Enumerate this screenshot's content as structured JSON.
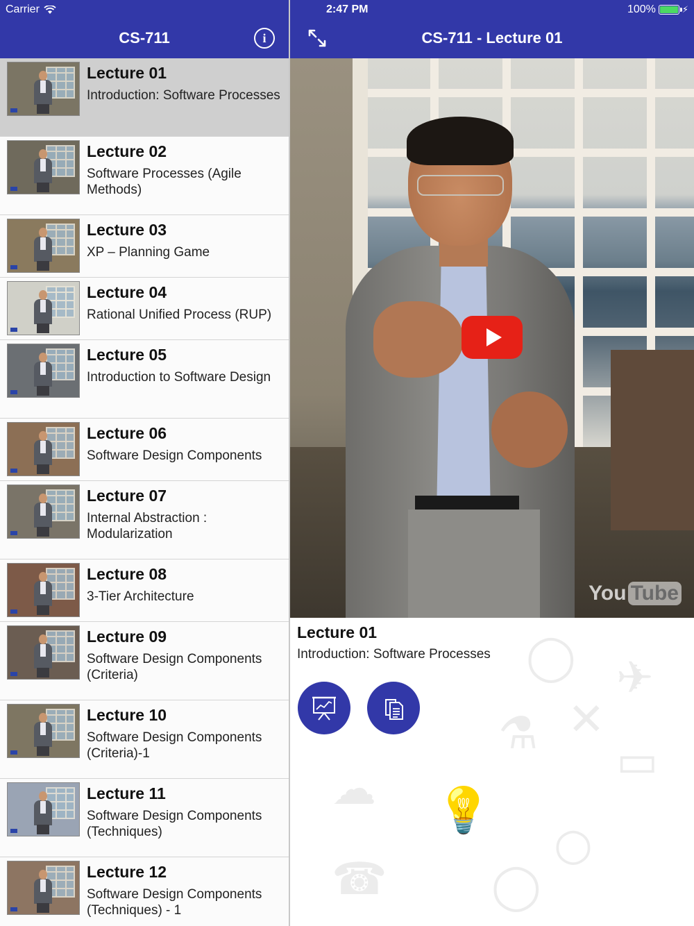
{
  "status_bar": {
    "carrier": "Carrier",
    "time": "2:47 PM",
    "battery": "100%"
  },
  "left_nav": {
    "title": "CS-711",
    "info_icon": "info-icon"
  },
  "right_nav": {
    "title": "CS-711 - Lecture 01",
    "expand_icon": "expand-icon"
  },
  "lectures": [
    {
      "title": "Lecture 01",
      "subtitle": "Introduction: Software Processes"
    },
    {
      "title": "Lecture 02",
      "subtitle": "Software Processes (Agile Methods)"
    },
    {
      "title": "Lecture 03",
      "subtitle": "XP – Planning Game"
    },
    {
      "title": "Lecture 04",
      "subtitle": "Rational Unified Process (RUP)"
    },
    {
      "title": "Lecture 05",
      "subtitle": "Introduction to Software Design"
    },
    {
      "title": "Lecture 06",
      "subtitle": "Software Design Components"
    },
    {
      "title": "Lecture 07",
      "subtitle": "Internal Abstraction : Modularization"
    },
    {
      "title": "Lecture 08",
      "subtitle": "3-Tier Architecture"
    },
    {
      "title": "Lecture 09",
      "subtitle": "Software Design Components (Criteria)"
    },
    {
      "title": "Lecture 10",
      "subtitle": "Software Design Components (Criteria)-1"
    },
    {
      "title": "Lecture 11",
      "subtitle": "Software Design Components (Techniques)"
    },
    {
      "title": "Lecture 12",
      "subtitle": "Software Design Components (Techniques) - 1"
    }
  ],
  "selected_index": 0,
  "video": {
    "watermark_you": "You",
    "watermark_tube": "Tube",
    "play_icon": "youtube-play-icon"
  },
  "details": {
    "title": "Lecture 01",
    "subtitle": "Introduction: Software Processes",
    "buttons": [
      "presentation-icon",
      "handouts-icon"
    ]
  },
  "colors": {
    "header": "#3238a8",
    "selected_row": "#cfcfcf",
    "play_button": "#e62117",
    "battery": "#4cd964"
  }
}
